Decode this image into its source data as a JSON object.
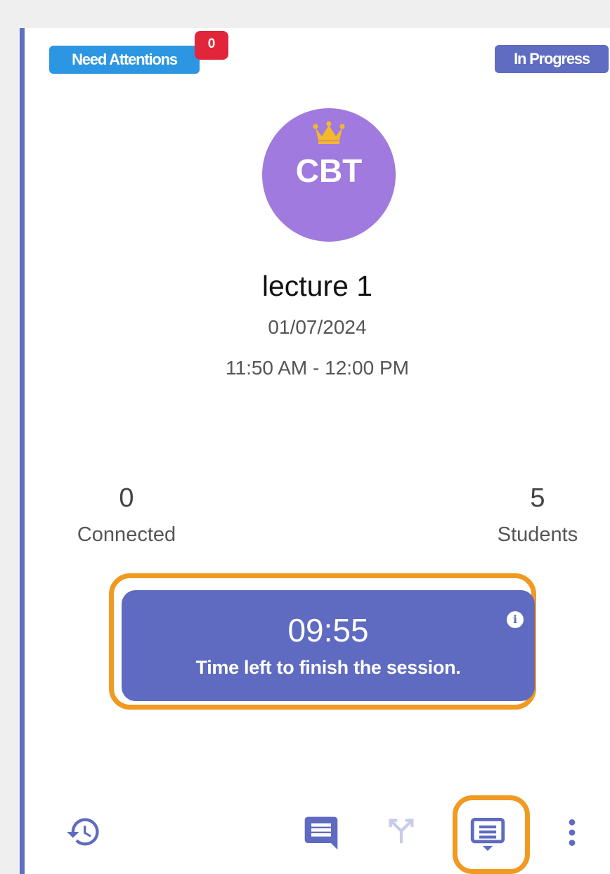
{
  "badges": {
    "need_attention": "Need Attentions",
    "attention_count": "0",
    "status": "In Progress"
  },
  "session": {
    "avatar_text": "CBT",
    "avatar_icon": "crown-icon",
    "title": "lecture 1",
    "date": "01/07/2024",
    "time_range": "11:50 AM - 12:00 PM"
  },
  "stats": {
    "connected_value": "0",
    "connected_label": "Connected",
    "students_value": "5",
    "students_label": "Students"
  },
  "timer": {
    "value": "09:55",
    "message": "Time left to finish the session.",
    "info_icon": "info-icon"
  },
  "toolbar": {
    "icons": [
      "history-icon",
      "chat-icon",
      "split-icon",
      "presentation-icon",
      "more-vert-icon"
    ]
  },
  "colors": {
    "accent": "#5f6bc0",
    "attention": "#2d96e2",
    "badge_red": "#e1253b",
    "avatar": "#a07ade",
    "crown": "#f5b82a",
    "highlight": "#f09a22"
  }
}
